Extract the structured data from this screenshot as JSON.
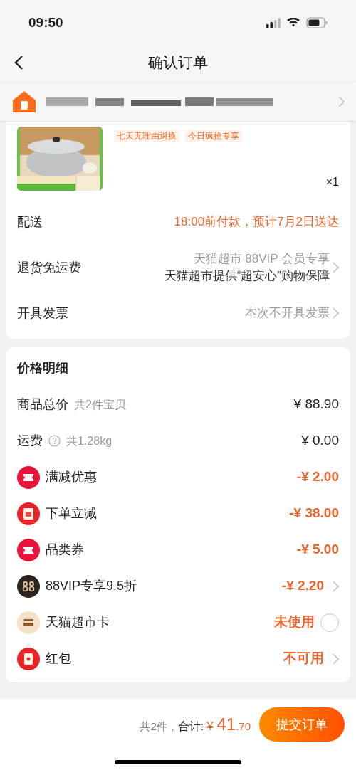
{
  "status_bar": {
    "time": "09:50"
  },
  "header": {
    "title": "确认订单"
  },
  "product": {
    "tags": [
      "七天无理由退换",
      "今日疯抢专享"
    ],
    "quantity": "×1"
  },
  "order_rows": [
    {
      "label": "配送",
      "lines": [
        "18:00前付款，预计7月2日送达"
      ],
      "accent": true,
      "chevron": false
    },
    {
      "label": "退货免运费",
      "lines": [
        "天猫超市 88VIP 会员专享",
        "天猫超市提供“超安心”购物保障"
      ],
      "accent": false,
      "chevron": true
    },
    {
      "label": "开具发票",
      "lines": [
        "本次不开具发票"
      ],
      "accent": false,
      "chevron": true
    }
  ],
  "price_detail": {
    "title": "价格明细",
    "rows": [
      {
        "kind": "plain",
        "label": "商品总价",
        "note": "共2件宝贝",
        "help": false,
        "value": "¥ 88.90",
        "accent": false,
        "chevron": false
      },
      {
        "kind": "plain",
        "label": "运费",
        "note": "共1.28kg",
        "help": true,
        "value": "¥ 0.00",
        "accent": false,
        "chevron": false
      },
      {
        "kind": "coupon",
        "label": "满减优惠",
        "value": "-¥ 2.00",
        "accent": true,
        "chevron": false
      },
      {
        "kind": "discount",
        "label": "下单立减",
        "value": "-¥ 38.00",
        "accent": true,
        "chevron": false
      },
      {
        "kind": "coupon",
        "label": "品类券",
        "value": "-¥ 5.00",
        "accent": true,
        "chevron": false
      },
      {
        "kind": "vip",
        "label": "88VIP专享9.5折",
        "value": "-¥ 2.20",
        "accent": true,
        "chevron": true
      },
      {
        "kind": "card",
        "label": "天猫超市卡",
        "value": "未使用",
        "accent": true,
        "chevron": false,
        "checked": false
      },
      {
        "kind": "redpacket",
        "label": "红包",
        "value": "不可用",
        "accent": true,
        "chevron": true
      }
    ]
  },
  "footer": {
    "count": "共2件，",
    "total_label": "合计:",
    "currency": "¥",
    "integer": "41",
    "decimal": ".70",
    "submit": "提交订单"
  }
}
